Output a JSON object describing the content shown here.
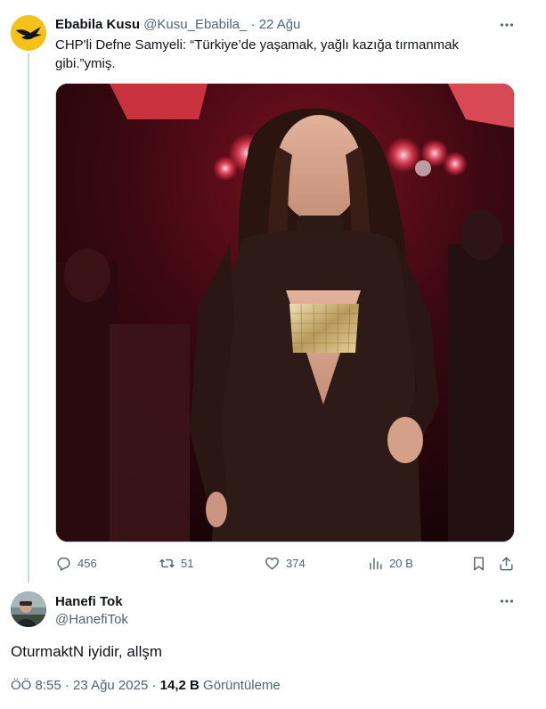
{
  "parent_tweet": {
    "author_name": "Ebabila Kusu",
    "author_handle": "@Kusu_Ebabila_",
    "separator": "·",
    "date": "22 Ağu",
    "text": "CHP'li Defne Samyeli: “Türkiye’de yaşamak, yağlı kazığa tırmanmak gibi.”ymiş.",
    "avatar_icon": "swallow-bird-icon",
    "media": {
      "kind": "photo",
      "subject": "woman-in-black-dress-photo"
    },
    "actions": {
      "replies": "456",
      "retweets": "51",
      "likes": "374",
      "views": "20 B"
    }
  },
  "reply_tweet": {
    "author_name": "Hanefi Tok",
    "author_handle": "@HanefiTok",
    "text": "OturmaktN iyidir, allşm",
    "time": "ÖÖ 8:55",
    "separator": "·",
    "date": "23 Ağu 2025",
    "views_count": "14,2 B",
    "views_label": "Görüntüleme"
  },
  "colors": {
    "text_primary": "#0f1419",
    "text_secondary": "#536471",
    "border": "#cfd9de",
    "avatar_yellow": "#f4c21a"
  }
}
